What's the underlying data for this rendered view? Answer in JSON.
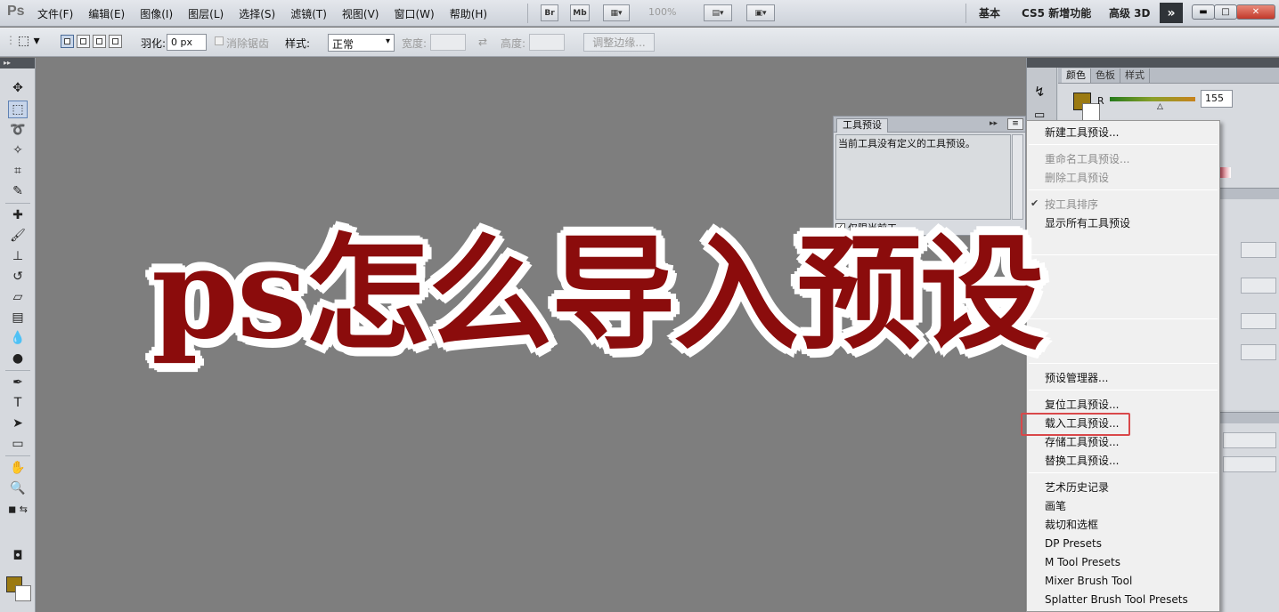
{
  "app": {
    "logo": "Ps"
  },
  "menubar": {
    "items": [
      "文件(F)",
      "编辑(E)",
      "图像(I)",
      "图层(L)",
      "选择(S)",
      "滤镜(T)",
      "视图(V)",
      "窗口(W)",
      "帮助(H)"
    ],
    "bridge": "Br",
    "mini_bridge": "Mb",
    "zoom": "100%",
    "workspaces": [
      "基本",
      "CS5 新增功能",
      "高级 3D"
    ],
    "more": "»"
  },
  "options": {
    "feather_label": "羽化:",
    "feather_value": "0 px",
    "antialias_label": "消除锯齿",
    "style_label": "样式:",
    "style_value": "正常",
    "width_label": "宽度:",
    "height_label": "高度:",
    "refine_edge": "调整边缘..."
  },
  "preset_panel": {
    "tab": "工具预设",
    "empty_message": "当前工具没有定义的工具预设。",
    "current_only_label": "仅限当前工"
  },
  "color_panel": {
    "tabs": [
      "颜色",
      "色板",
      "样式"
    ],
    "channel_label": "R",
    "channel_value": "155",
    "fg_color": "#9b7a12"
  },
  "flyout_menu": {
    "items": [
      {
        "label": "新建工具预设...",
        "enabled": true
      },
      {
        "label": "重命名工具预设...",
        "enabled": false
      },
      {
        "label": "删除工具预设",
        "enabled": false
      },
      {
        "label": "按工具排序",
        "enabled": false,
        "checked": true
      },
      {
        "label": "显示所有工具预设",
        "enabled": true
      },
      {
        "label": "预设管理器...",
        "enabled": true
      },
      {
        "label": "复位工具预设...",
        "enabled": true
      },
      {
        "label": "载入工具预设...",
        "enabled": true,
        "highlighted": true
      },
      {
        "label": "存储工具预设...",
        "enabled": true
      },
      {
        "label": "替换工具预设...",
        "enabled": true
      },
      {
        "label": "艺术历史记录",
        "enabled": true
      },
      {
        "label": "画笔",
        "enabled": true
      },
      {
        "label": "裁切和选框",
        "enabled": true
      },
      {
        "label": "DP Presets",
        "enabled": true
      },
      {
        "label": "M Tool Presets",
        "enabled": true
      },
      {
        "label": "Mixer Brush Tool",
        "enabled": true
      },
      {
        "label": "Splatter Brush Tool Presets",
        "enabled": true
      }
    ]
  },
  "overlay": {
    "title": "ps怎么导入预设"
  },
  "colors": {
    "title_red": "#8b0c0c",
    "highlight_red": "#d9484a",
    "canvas_gray": "#7e7e7e",
    "fg_swatch": "#9b7a12"
  },
  "icons": {
    "tools": [
      "move-icon",
      "marquee-icon",
      "lasso-icon",
      "quick-select-icon",
      "crop-icon",
      "eyedropper-icon",
      "healing-icon",
      "brush-icon",
      "stamp-icon",
      "history-brush-icon",
      "eraser-icon",
      "gradient-icon",
      "blur-icon",
      "dodge-icon",
      "pen-icon",
      "type-icon",
      "path-select-icon",
      "shape-icon",
      "hand-icon",
      "zoom-icon"
    ]
  }
}
